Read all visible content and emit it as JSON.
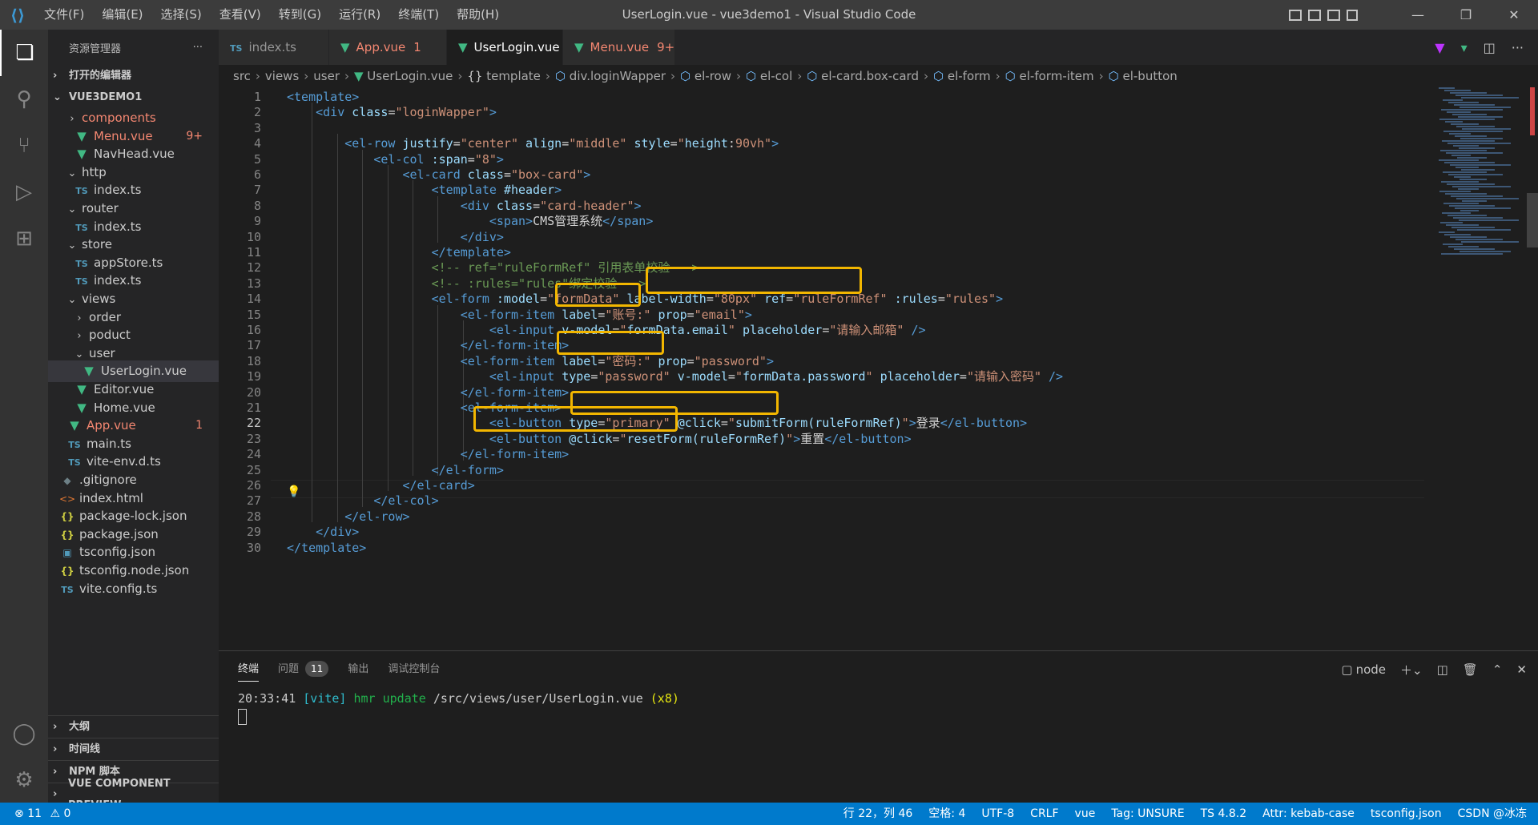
{
  "titlebar": {
    "menus": [
      "文件(F)",
      "编辑(E)",
      "选择(S)",
      "查看(V)",
      "转到(G)",
      "运行(R)",
      "终端(T)",
      "帮助(H)"
    ],
    "title": "UserLogin.vue - vue3demo1 - Visual Studio Code"
  },
  "sidebar": {
    "header": "资源管理器",
    "more": "···",
    "open_editors": "打开的编辑器",
    "project": "VUE3DEMO1",
    "items": [
      {
        "label": "components",
        "icon": "folder",
        "indent": 2,
        "status": "err"
      },
      {
        "label": "Menu.vue",
        "icon": "vue",
        "indent": 3,
        "badge": "9+",
        "status": "err"
      },
      {
        "label": "NavHead.vue",
        "icon": "vue",
        "indent": 3
      },
      {
        "label": "http",
        "icon": "folder-open",
        "indent": 2
      },
      {
        "label": "index.ts",
        "icon": "ts",
        "indent": 3
      },
      {
        "label": "router",
        "icon": "folder-open",
        "indent": 2
      },
      {
        "label": "index.ts",
        "icon": "ts",
        "indent": 3
      },
      {
        "label": "store",
        "icon": "folder-open",
        "indent": 2
      },
      {
        "label": "appStore.ts",
        "icon": "ts",
        "indent": 3
      },
      {
        "label": "index.ts",
        "icon": "ts",
        "indent": 3
      },
      {
        "label": "views",
        "icon": "folder-open",
        "indent": 2
      },
      {
        "label": "order",
        "icon": "folder",
        "indent": 3
      },
      {
        "label": "poduct",
        "icon": "folder",
        "indent": 3
      },
      {
        "label": "user",
        "icon": "folder-open",
        "indent": 3
      },
      {
        "label": "UserLogin.vue",
        "icon": "vue",
        "indent": 4,
        "selected": true
      },
      {
        "label": "Editor.vue",
        "icon": "vue",
        "indent": 3
      },
      {
        "label": "Home.vue",
        "icon": "vue",
        "indent": 3
      },
      {
        "label": "App.vue",
        "icon": "vue",
        "indent": 2,
        "badge": "1",
        "status": "err"
      },
      {
        "label": "main.ts",
        "icon": "ts",
        "indent": 2
      },
      {
        "label": "vite-env.d.ts",
        "icon": "ts",
        "indent": 2
      },
      {
        "label": ".gitignore",
        "icon": "git",
        "indent": 1
      },
      {
        "label": "index.html",
        "icon": "html",
        "indent": 1
      },
      {
        "label": "package-lock.json",
        "icon": "json",
        "indent": 1
      },
      {
        "label": "package.json",
        "icon": "json",
        "indent": 1
      },
      {
        "label": "tsconfig.json",
        "icon": "tsconfig",
        "indent": 1
      },
      {
        "label": "tsconfig.node.json",
        "icon": "json",
        "indent": 1
      },
      {
        "label": "vite.config.ts",
        "icon": "ts",
        "indent": 1
      }
    ],
    "bottom_sections": [
      "大纲",
      "时间线",
      "NPM 脚本",
      "VUE COMPONENT PREVIEW"
    ]
  },
  "tabs": [
    {
      "label": "index.ts",
      "icon": "TS"
    },
    {
      "label": "App.vue",
      "badge": "1",
      "status": "err"
    },
    {
      "label": "UserLogin.vue",
      "active": true,
      "close": "✕"
    },
    {
      "label": "Menu.vue",
      "badge": "9+",
      "status": "err"
    }
  ],
  "breadcrumb": [
    "src",
    "views",
    "user",
    "UserLogin.vue",
    "template",
    "div.loginWapper",
    "el-row",
    "el-col",
    "el-card.box-card",
    "el-form",
    "el-form-item",
    "el-button"
  ],
  "code_lines": [
    {
      "n": "1",
      "t": [
        [
          "tg",
          "<template>"
        ]
      ]
    },
    {
      "n": "2",
      "t": [
        [
          "tx",
          "    "
        ],
        [
          "tg",
          "<div "
        ],
        [
          "at",
          "class"
        ],
        [
          "tx",
          "="
        ],
        [
          "st",
          "\"loginWapper\""
        ],
        [
          "tg",
          ">"
        ]
      ]
    },
    {
      "n": "3",
      "t": []
    },
    {
      "n": "4",
      "t": [
        [
          "tx",
          "        "
        ],
        [
          "tg",
          "<el-row "
        ],
        [
          "at",
          "justify"
        ],
        [
          "tx",
          "="
        ],
        [
          "st",
          "\"center\""
        ],
        [
          "tx",
          " "
        ],
        [
          "at",
          "align"
        ],
        [
          "tx",
          "="
        ],
        [
          "st",
          "\"middle\""
        ],
        [
          "tx",
          " "
        ],
        [
          "at",
          "style"
        ],
        [
          "tx",
          "="
        ],
        [
          "st",
          "\""
        ],
        [
          "at",
          "height"
        ],
        [
          "tx",
          ":"
        ],
        [
          "st",
          "90vh\""
        ],
        [
          "tg",
          ">"
        ]
      ]
    },
    {
      "n": "5",
      "t": [
        [
          "tx",
          "            "
        ],
        [
          "tg",
          "<el-col "
        ],
        [
          "at",
          ":span"
        ],
        [
          "tx",
          "="
        ],
        [
          "st",
          "\"8\""
        ],
        [
          "tg",
          ">"
        ]
      ]
    },
    {
      "n": "6",
      "t": [
        [
          "tx",
          "                "
        ],
        [
          "tg",
          "<el-card "
        ],
        [
          "at",
          "class"
        ],
        [
          "tx",
          "="
        ],
        [
          "st",
          "\"box-card\""
        ],
        [
          "tg",
          ">"
        ]
      ]
    },
    {
      "n": "7",
      "t": [
        [
          "tx",
          "                    "
        ],
        [
          "tg",
          "<template "
        ],
        [
          "at",
          "#header"
        ],
        [
          "tg",
          ">"
        ]
      ]
    },
    {
      "n": "8",
      "t": [
        [
          "tx",
          "                        "
        ],
        [
          "tg",
          "<div "
        ],
        [
          "at",
          "class"
        ],
        [
          "tx",
          "="
        ],
        [
          "st",
          "\"card-header\""
        ],
        [
          "tg",
          ">"
        ]
      ]
    },
    {
      "n": "9",
      "t": [
        [
          "tx",
          "                            "
        ],
        [
          "tg",
          "<span>"
        ],
        [
          "tx",
          "CMS管理系统"
        ],
        [
          "tg",
          "</span>"
        ]
      ]
    },
    {
      "n": "10",
      "t": [
        [
          "tx",
          "                        "
        ],
        [
          "tg",
          "</div>"
        ]
      ]
    },
    {
      "n": "11",
      "t": [
        [
          "tx",
          "                    "
        ],
        [
          "tg",
          "</template>"
        ]
      ]
    },
    {
      "n": "12",
      "t": [
        [
          "tx",
          "                    "
        ],
        [
          "cm",
          "<!-- ref=\"ruleFormRef\" 引用表单校验 -->"
        ]
      ]
    },
    {
      "n": "13",
      "t": [
        [
          "tx",
          "                    "
        ],
        [
          "cm",
          "<!-- :rules=\"rules\"绑定校验 -->"
        ]
      ]
    },
    {
      "n": "14",
      "t": [
        [
          "tx",
          "                    "
        ],
        [
          "tg",
          "<el-form "
        ],
        [
          "at",
          ":model"
        ],
        [
          "tx",
          "="
        ],
        [
          "st",
          "\"formData\""
        ],
        [
          "tx",
          " "
        ],
        [
          "at",
          "label-width"
        ],
        [
          "tx",
          "="
        ],
        [
          "st",
          "\"80px\""
        ],
        [
          "tx",
          " "
        ],
        [
          "at",
          "ref"
        ],
        [
          "tx",
          "="
        ],
        [
          "st",
          "\"ruleFormRef\""
        ],
        [
          "tx",
          " "
        ],
        [
          "at",
          ":rules"
        ],
        [
          "tx",
          "="
        ],
        [
          "st",
          "\"rules\""
        ],
        [
          "tg",
          ">"
        ]
      ]
    },
    {
      "n": "15",
      "t": [
        [
          "tx",
          "                        "
        ],
        [
          "tg",
          "<el-form-item "
        ],
        [
          "at",
          "label"
        ],
        [
          "tx",
          "="
        ],
        [
          "st",
          "\"账号:\""
        ],
        [
          "tx",
          " "
        ],
        [
          "at",
          "prop"
        ],
        [
          "tx",
          "="
        ],
        [
          "st",
          "\"email\""
        ],
        [
          "tg",
          ">"
        ]
      ]
    },
    {
      "n": "16",
      "t": [
        [
          "tx",
          "                            "
        ],
        [
          "tg",
          "<el-input "
        ],
        [
          "at",
          "v-model"
        ],
        [
          "tx",
          "="
        ],
        [
          "st",
          "\""
        ],
        [
          "at",
          "formData.email"
        ],
        [
          "st",
          "\""
        ],
        [
          "tx",
          " "
        ],
        [
          "at",
          "placeholder"
        ],
        [
          "tx",
          "="
        ],
        [
          "st",
          "\"请输入邮箱\""
        ],
        [
          "tx",
          " "
        ],
        [
          "tg",
          "/>"
        ]
      ]
    },
    {
      "n": "17",
      "t": [
        [
          "tx",
          "                        "
        ],
        [
          "tg",
          "</el-form-item>"
        ]
      ]
    },
    {
      "n": "18",
      "t": [
        [
          "tx",
          "                        "
        ],
        [
          "tg",
          "<el-form-item "
        ],
        [
          "at",
          "label"
        ],
        [
          "tx",
          "="
        ],
        [
          "st",
          "\"密码:\""
        ],
        [
          "tx",
          " "
        ],
        [
          "at",
          "prop"
        ],
        [
          "tx",
          "="
        ],
        [
          "st",
          "\"password\""
        ],
        [
          "tg",
          ">"
        ]
      ]
    },
    {
      "n": "19",
      "t": [
        [
          "tx",
          "                            "
        ],
        [
          "tg",
          "<el-input "
        ],
        [
          "at",
          "type"
        ],
        [
          "tx",
          "="
        ],
        [
          "st",
          "\"password\""
        ],
        [
          "tx",
          " "
        ],
        [
          "at",
          "v-model"
        ],
        [
          "tx",
          "="
        ],
        [
          "st",
          "\""
        ],
        [
          "at",
          "formData.password"
        ],
        [
          "st",
          "\""
        ],
        [
          "tx",
          " "
        ],
        [
          "at",
          "placeholder"
        ],
        [
          "tx",
          "="
        ],
        [
          "st",
          "\"请输入密码\""
        ],
        [
          "tx",
          " "
        ],
        [
          "tg",
          "/>"
        ]
      ]
    },
    {
      "n": "20",
      "t": [
        [
          "tx",
          "                        "
        ],
        [
          "tg",
          "</el-form-item>"
        ]
      ]
    },
    {
      "n": "21",
      "t": [
        [
          "tx",
          "                        "
        ],
        [
          "tg",
          "<el-form-item>"
        ]
      ]
    },
    {
      "n": "22",
      "t": [
        [
          "tx",
          "                            "
        ],
        [
          "tg",
          "<el-button "
        ],
        [
          "at",
          "type"
        ],
        [
          "tx",
          "="
        ],
        [
          "st",
          "\"primary\""
        ],
        [
          "tx",
          " "
        ],
        [
          "at",
          "@click"
        ],
        [
          "tx",
          "="
        ],
        [
          "st",
          "\""
        ],
        [
          "at",
          "submitForm(ruleFormRef)"
        ],
        [
          "st",
          "\""
        ],
        [
          "tg",
          ">"
        ],
        [
          "tx",
          "登录"
        ],
        [
          "tg",
          "</el-button>"
        ]
      ]
    },
    {
      "n": "23",
      "t": [
        [
          "tx",
          "                            "
        ],
        [
          "tg",
          "<el-button "
        ],
        [
          "at",
          "@click"
        ],
        [
          "tx",
          "="
        ],
        [
          "st",
          "\""
        ],
        [
          "at",
          "resetForm(ruleFormRef)"
        ],
        [
          "st",
          "\""
        ],
        [
          "tg",
          ">"
        ],
        [
          "tx",
          "重置"
        ],
        [
          "tg",
          "</el-button>"
        ]
      ]
    },
    {
      "n": "24",
      "t": [
        [
          "tx",
          "                        "
        ],
        [
          "tg",
          "</el-form-item>"
        ]
      ]
    },
    {
      "n": "25",
      "t": [
        [
          "tx",
          "                    "
        ],
        [
          "tg",
          "</el-form>"
        ]
      ]
    },
    {
      "n": "26",
      "t": [
        [
          "tx",
          "                "
        ],
        [
          "tg",
          "</el-card>"
        ]
      ]
    },
    {
      "n": "27",
      "t": [
        [
          "tx",
          "            "
        ],
        [
          "tg",
          "</el-col>"
        ]
      ]
    },
    {
      "n": "28",
      "t": [
        [
          "tx",
          "        "
        ],
        [
          "tg",
          "</el-row>"
        ]
      ]
    },
    {
      "n": "29",
      "t": [
        [
          "tx",
          "    "
        ],
        [
          "tg",
          "</div>"
        ]
      ]
    },
    {
      "n": "30",
      "t": [
        [
          "tg",
          "</template>"
        ]
      ]
    }
  ],
  "panel": {
    "tabs": [
      {
        "label": "终端",
        "active": true
      },
      {
        "label": "问题",
        "badge": "11"
      },
      {
        "label": "输出"
      },
      {
        "label": "调试控制台"
      }
    ],
    "terminal_profile": "node",
    "terminal": {
      "time": "20:33:41",
      "tag": "[vite]",
      "action": "hmr update",
      "path": "/src/views/user/UserLogin.vue",
      "count": "(x8)"
    }
  },
  "statusbar": {
    "errors": "11",
    "warnings": "0",
    "right": [
      "行 22，列 46",
      "空格: 4",
      "UTF-8",
      "CRLF",
      "vue",
      "Tag: UNSURE",
      "TS 4.8.2",
      "Attr: kebab-case",
      "tsconfig.json",
      "CSDN @冰冻"
    ]
  },
  "colors": {
    "accent": "#007acc",
    "highlight_box": "#f2b600",
    "error_text": "#f48771"
  }
}
